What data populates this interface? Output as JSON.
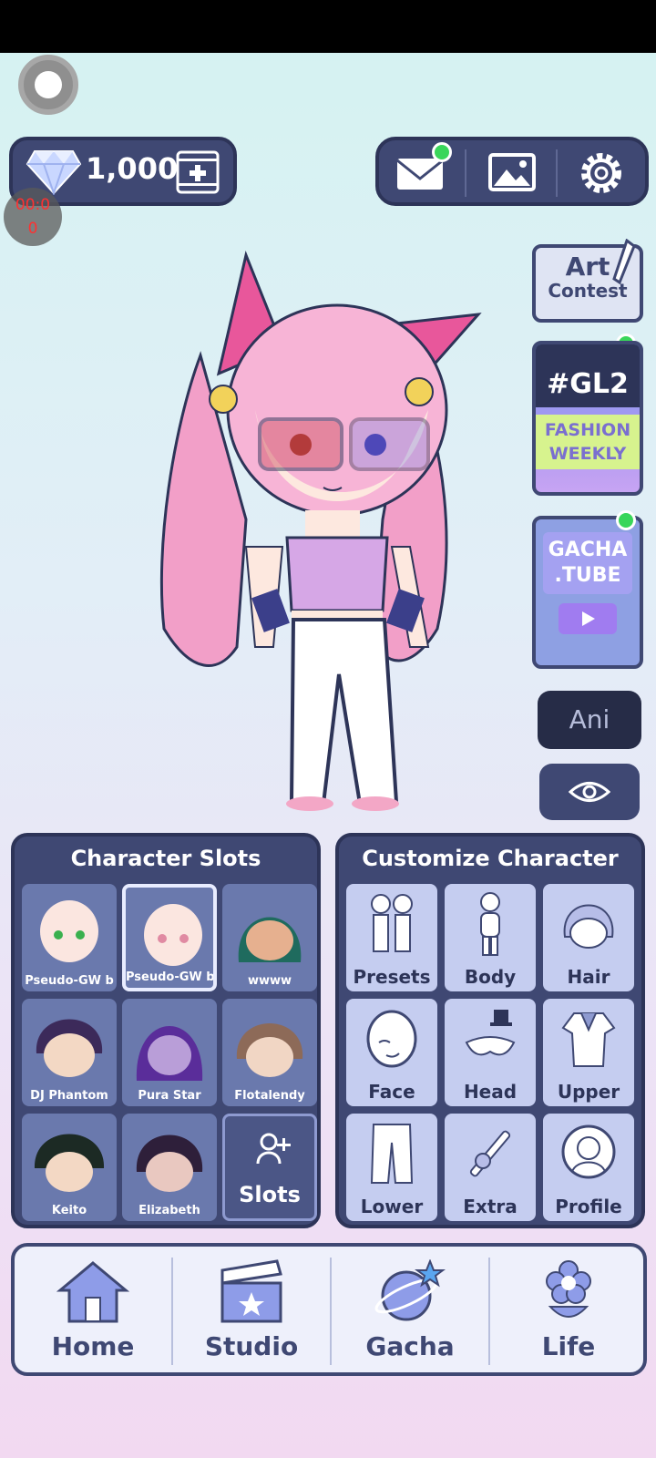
{
  "currency": {
    "gems": "1,000"
  },
  "timer": {
    "line1": "00:0",
    "line2": "0"
  },
  "side": {
    "art_contest": {
      "line1": "Art",
      "line2": "Contest"
    },
    "gl2": {
      "tag": "#GL2",
      "line1": "FASHION",
      "line2": "WEEKLY"
    },
    "gacha_tube": {
      "line1": "GACHA",
      "line2": ".TUBE"
    },
    "ani_label": "Ani"
  },
  "character_slots": {
    "title": "Character Slots",
    "slots": [
      {
        "name": "Pseudo-GW b"
      },
      {
        "name": "Pseudo-GW b"
      },
      {
        "name": "wwww"
      },
      {
        "name": "DJ Phantom"
      },
      {
        "name": "Pura Star"
      },
      {
        "name": "Flotalendy"
      },
      {
        "name": "Keito"
      },
      {
        "name": "Elizabeth"
      }
    ],
    "add_label": "Slots"
  },
  "customize": {
    "title": "Customize Character",
    "items": [
      {
        "label": "Presets"
      },
      {
        "label": "Body"
      },
      {
        "label": "Hair"
      },
      {
        "label": "Face"
      },
      {
        "label": "Head"
      },
      {
        "label": "Upper"
      },
      {
        "label": "Lower"
      },
      {
        "label": "Extra"
      },
      {
        "label": "Profile"
      }
    ]
  },
  "nav": [
    {
      "label": "Home",
      "icon": "house-icon"
    },
    {
      "label": "Studio",
      "icon": "clapperboard-icon"
    },
    {
      "label": "Gacha",
      "icon": "planet-star-icon"
    },
    {
      "label": "Life",
      "icon": "flower-icon"
    }
  ],
  "colors": {
    "panel": "#3f4873",
    "panel_border": "#2d3458",
    "notification": "#39d65a",
    "accent_pink": "#e8579b"
  }
}
